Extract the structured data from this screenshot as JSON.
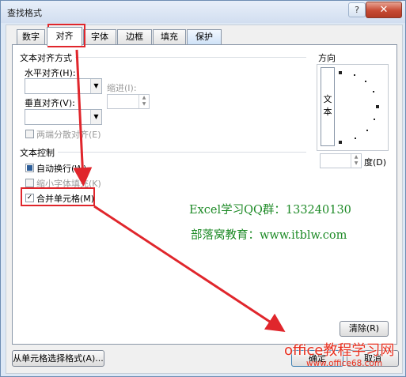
{
  "title": "查找格式",
  "help_label": "?",
  "close_label": "✕",
  "tabs": [
    {
      "label": "数字"
    },
    {
      "label": "对齐"
    },
    {
      "label": "字体"
    },
    {
      "label": "边框"
    },
    {
      "label": "填充"
    },
    {
      "label": "保护"
    }
  ],
  "active_tab": "对齐",
  "alignment": {
    "section_title": "文本对齐方式",
    "horizontal_label": "水平对齐(H):",
    "horizontal_value": "",
    "indent_label": "缩进(I):",
    "indent_value": "",
    "vertical_label": "垂直对齐(V):",
    "vertical_value": "",
    "justify_distributed_label": "两端分散对齐(E)"
  },
  "text_control": {
    "section_title": "文本控制",
    "wrap_text_label": "自动换行(W)",
    "shrink_to_fit_label": "缩小字体填充(K)",
    "merge_cells_label": "合并单元格(M)",
    "merge_cells_checked": true
  },
  "orientation": {
    "section_title": "方向",
    "vertical_text": [
      "文",
      "本"
    ],
    "degree_value": "",
    "degree_label": "度(D)"
  },
  "buttons": {
    "clear": "清除(R)",
    "choose_from_cell": "从单元格选择格式(A)...",
    "ok": "确定",
    "cancel": "取消"
  },
  "watermark": {
    "qq_group": "Excel学习QQ群：133240130",
    "site": "部落窝教育：www.itblw.com",
    "brand": "office教程学习网",
    "brand_url": "www.office68.com"
  },
  "colors": {
    "highlight_red": "#e0262c",
    "watermark_green": "#1d8a26",
    "brand_red": "#e82f1e"
  }
}
